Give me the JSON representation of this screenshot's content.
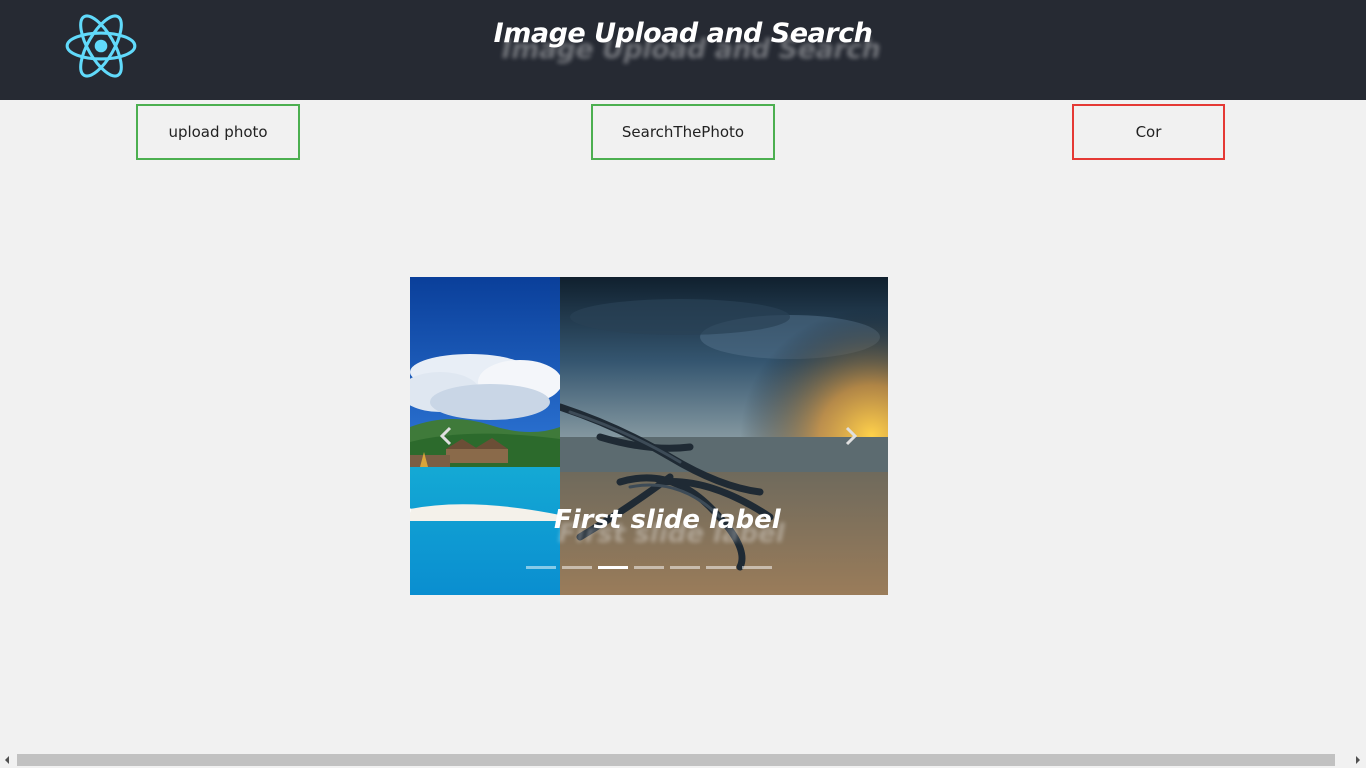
{
  "header": {
    "title": "Image Upload and Search",
    "logo_icon": "react-atom-icon",
    "background": "#262a33",
    "logo_color": "#61dafb"
  },
  "nav": {
    "upload_label": "upload photo",
    "search_label": "SearchThePhoto",
    "cor_label": "Cor",
    "upload_border": "#4caf50",
    "search_border": "#4caf50",
    "cor_border": "#e53935"
  },
  "carousel": {
    "caption": "First slide label",
    "slides": [
      {
        "scene": "tropical-beach-huts-photo"
      },
      {
        "scene": "driftwood-beach-sunset-photo"
      }
    ],
    "prev_icon": "chevron-left-icon",
    "next_icon": "chevron-right-icon",
    "indicator_count": 7,
    "active_indicator": 3
  }
}
